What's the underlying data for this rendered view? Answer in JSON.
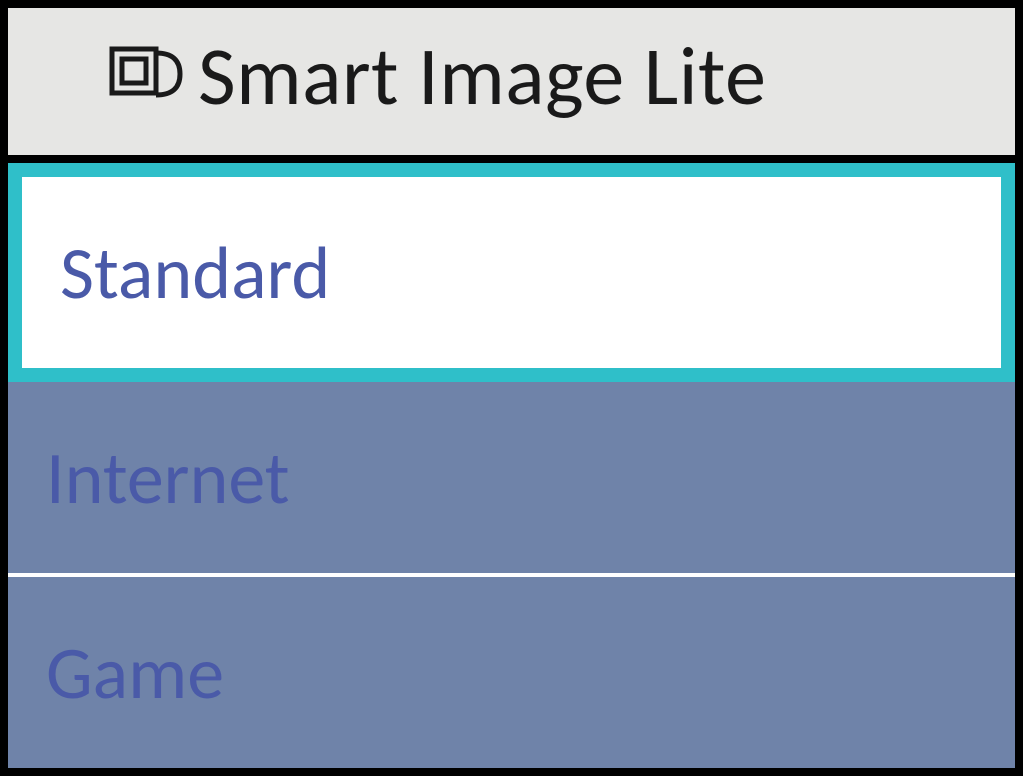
{
  "header": {
    "title": "Smart Image Lite"
  },
  "menu": {
    "items": [
      {
        "label": "Standard",
        "selected": true
      },
      {
        "label": "Internet",
        "selected": false
      },
      {
        "label": "Game",
        "selected": false
      }
    ]
  },
  "colors": {
    "headerBg": "#e6e6e4",
    "highlightBorder": "#2fbfc9",
    "unselectedBg": "#6f83a9",
    "textColor": "#4a5aa8",
    "frameBlack": "#000000"
  }
}
